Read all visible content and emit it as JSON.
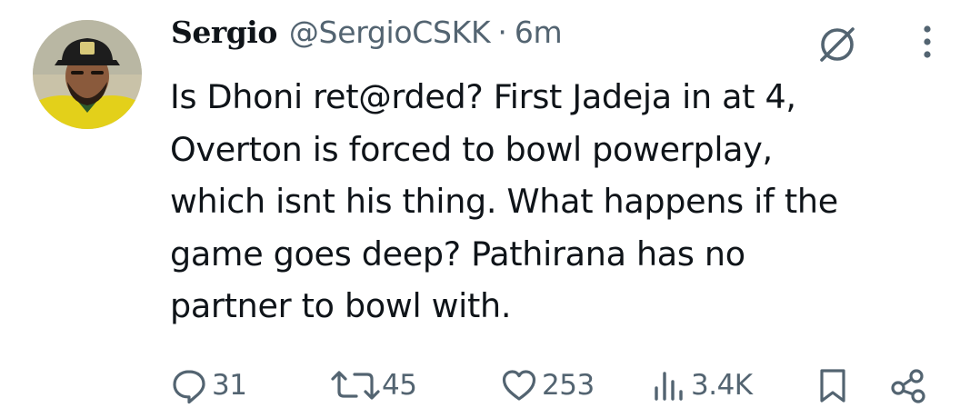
{
  "tweet": {
    "author": {
      "display_name": "Sergio",
      "handle": "@SergioCSKK",
      "separator": "·",
      "time": "6m"
    },
    "text": "Is Dhoni ret@rded? First Jadeja in at 4,\nOverton is forced to bowl powerplay,\nwhich isnt his thing. What happens if the\ngame goes deep? Pathirana has no\npartner to bowl with.",
    "actions": {
      "replies": "31",
      "retweets": "45",
      "likes": "253",
      "views": "3.4K"
    }
  },
  "icons": {
    "grok": "grok-icon",
    "more": "more-vertical-icon",
    "reply": "reply-icon",
    "retweet": "retweet-icon",
    "like": "heart-icon",
    "views": "views-icon",
    "bookmark": "bookmark-icon",
    "share": "share-icon"
  },
  "colors": {
    "text": "#0f1419",
    "secondary": "#536471",
    "avatar_shirt": "#e7d21c"
  }
}
